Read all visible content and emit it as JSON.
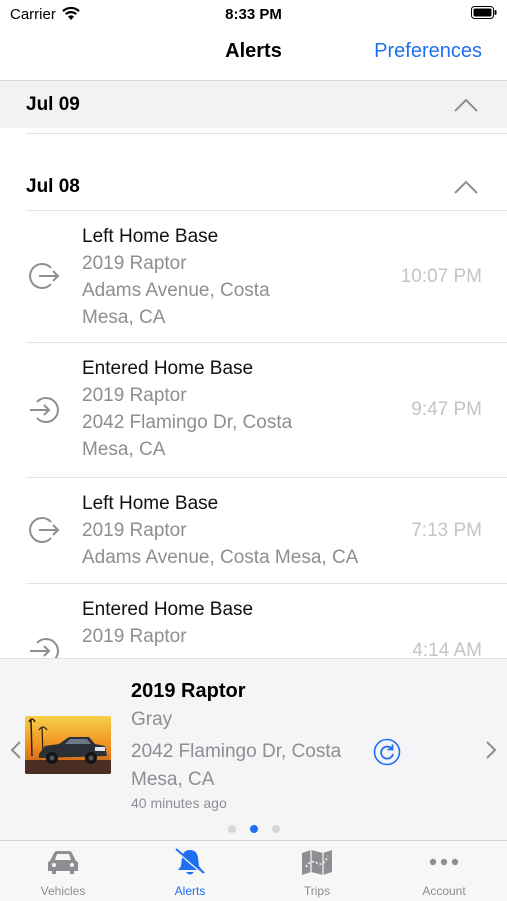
{
  "status_bar": {
    "carrier": "Carrier",
    "time": "8:33 PM"
  },
  "nav": {
    "title": "Alerts",
    "preferences": "Preferences"
  },
  "sections": [
    {
      "title": "Jul 09",
      "expanded": true
    },
    {
      "title": "Jul 08",
      "expanded": true
    }
  ],
  "alerts": [
    {
      "title": "Left Home Base",
      "vehicle": "2019 Raptor",
      "address_line1": "Adams Avenue, Costa",
      "address_line2": "Mesa, CA",
      "time": "10:07 PM",
      "icon": "exit-icon"
    },
    {
      "title": "Entered Home Base",
      "vehicle": "2019 Raptor",
      "address_line1": "2042 Flamingo Dr, Costa",
      "address_line2": "Mesa, CA",
      "time": "9:47 PM",
      "icon": "enter-icon"
    },
    {
      "title": "Left Home Base",
      "vehicle": "2019 Raptor",
      "address_line1": "Adams Avenue, Costa Mesa, CA",
      "address_line2": "",
      "time": "7:13 PM",
      "icon": "exit-icon"
    },
    {
      "title": "Entered Home Base",
      "vehicle": "2019 Raptor",
      "address_line1": "",
      "address_line2": "",
      "time": "4:14 AM",
      "icon": "enter-icon"
    }
  ],
  "vehicle_card": {
    "name": "2019 Raptor",
    "color": "Gray",
    "address_line1": "2042 Flamingo Dr, Costa",
    "address_line2": "Mesa, CA",
    "updated": "40 minutes ago",
    "page_count": 3,
    "active_page": 1
  },
  "tabs": [
    {
      "label": "Vehicles",
      "icon": "car-icon",
      "active": false
    },
    {
      "label": "Alerts",
      "icon": "bell-icon",
      "active": true
    },
    {
      "label": "Trips",
      "icon": "map-icon",
      "active": false
    },
    {
      "label": "Account",
      "icon": "more-icon",
      "active": false
    }
  ],
  "colors": {
    "accent": "#1f6ff2",
    "secondary_text": "#8e8e93",
    "time_text": "#c4c4c8",
    "icon_grey": "#8e8e93"
  }
}
